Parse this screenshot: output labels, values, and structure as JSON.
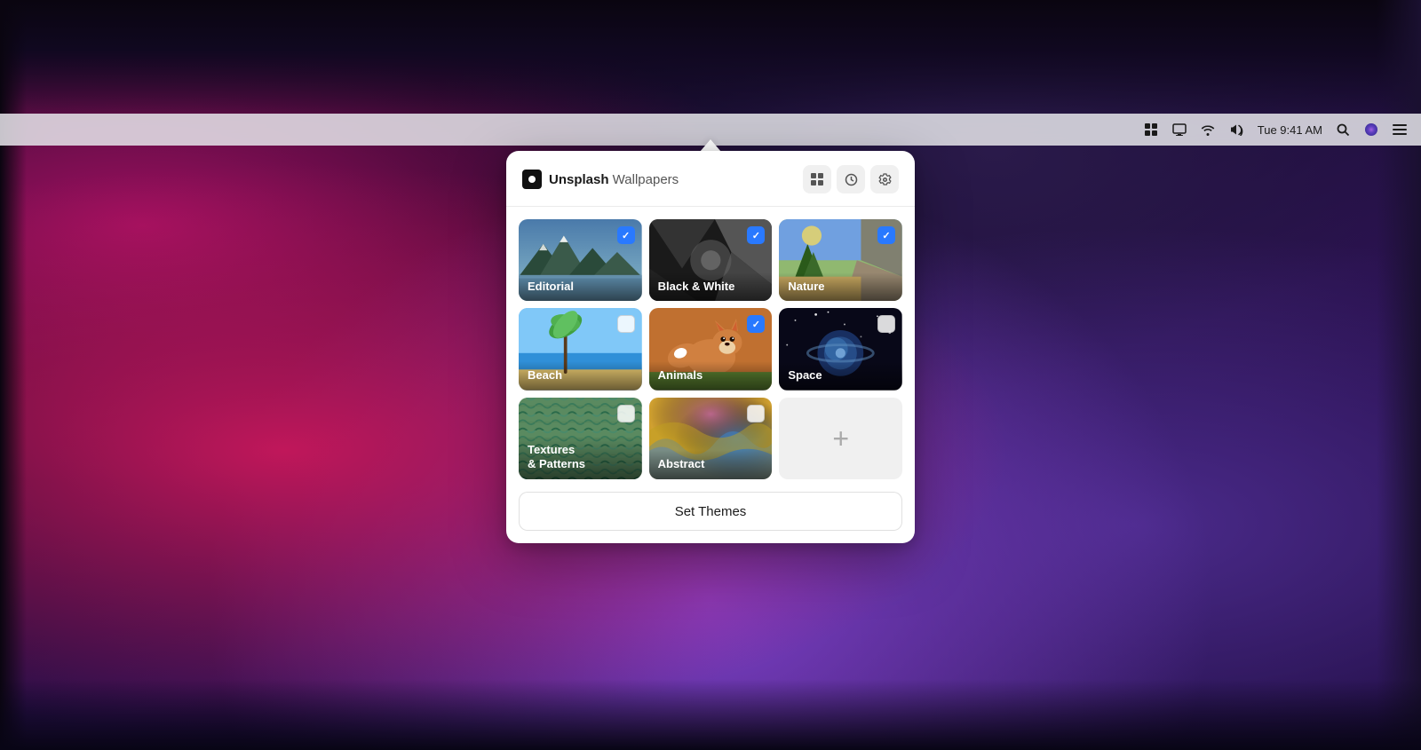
{
  "desktop": {
    "bg_description": "Abstract fluid art with pink, purple, blue tones"
  },
  "menubar": {
    "time": "Tue 9:41 AM",
    "icons": [
      "grid-icon",
      "monitor-icon",
      "wifi-icon",
      "volume-icon",
      "search-icon",
      "siri-icon",
      "menu-icon"
    ]
  },
  "popup": {
    "title": {
      "brand": "Unsplash",
      "subtitle": " Wallpapers"
    },
    "actions": {
      "grid_label": "⊞",
      "history_label": "◷",
      "settings_label": "⚙"
    },
    "categories": [
      {
        "id": "editorial",
        "label": "Editorial",
        "checked": true,
        "type": "checked"
      },
      {
        "id": "blackwhite",
        "label": "Black & White",
        "checked": true,
        "type": "checked"
      },
      {
        "id": "nature",
        "label": "Nature",
        "checked": true,
        "type": "checked"
      },
      {
        "id": "beach",
        "label": "Beach",
        "checked": false,
        "type": "unchecked"
      },
      {
        "id": "animals",
        "label": "Animals",
        "checked": true,
        "type": "checked"
      },
      {
        "id": "space",
        "label": "Space",
        "checked": false,
        "type": "unchecked"
      },
      {
        "id": "textures",
        "label": "Textures\n& Patterns",
        "checked": false,
        "type": "unchecked"
      },
      {
        "id": "abstract",
        "label": "Abstract",
        "checked": false,
        "type": "unchecked"
      },
      {
        "id": "add",
        "label": "+",
        "type": "add"
      }
    ],
    "set_themes_button": "Set Themes"
  }
}
